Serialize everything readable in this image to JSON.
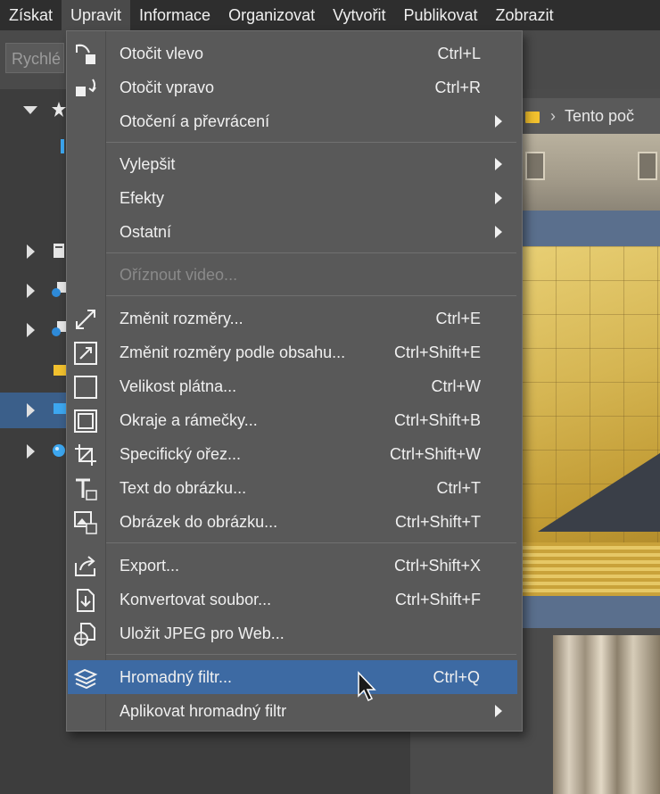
{
  "menubar": {
    "items": [
      "Získat",
      "Upravit",
      "Informace",
      "Organizovat",
      "Vytvořit",
      "Publikovat",
      "Zobrazit"
    ]
  },
  "search": {
    "text": "Rychlé"
  },
  "path": {
    "text": "Tento poč"
  },
  "dropdown": {
    "items": [
      {
        "label": "Otočit vlevo",
        "shortcut": "Ctrl+L",
        "icon": "rotate-left-icon"
      },
      {
        "label": "Otočit vpravo",
        "shortcut": "Ctrl+R",
        "icon": "rotate-right-icon"
      },
      {
        "label": "Otočení a převrácení",
        "shortcut": "",
        "submenu": true
      },
      {
        "label": "Vylepšit",
        "shortcut": "",
        "submenu": true
      },
      {
        "label": "Efekty",
        "shortcut": "",
        "submenu": true
      },
      {
        "label": "Ostatní",
        "shortcut": "",
        "submenu": true
      },
      {
        "label": "Oříznout video...",
        "shortcut": "",
        "disabled": true
      },
      {
        "label": "Změnit rozměry...",
        "shortcut": "Ctrl+E",
        "icon": "resize-icon"
      },
      {
        "label": "Změnit rozměry podle obsahu...",
        "shortcut": "Ctrl+Shift+E",
        "icon": "content-resize-icon"
      },
      {
        "label": "Velikost plátna...",
        "shortcut": "Ctrl+W",
        "icon": "canvas-size-icon"
      },
      {
        "label": "Okraje a rámečky...",
        "shortcut": "Ctrl+Shift+B",
        "icon": "frame-icon"
      },
      {
        "label": "Specifický ořez...",
        "shortcut": "Ctrl+Shift+W",
        "icon": "crop-icon"
      },
      {
        "label": "Text do obrázku...",
        "shortcut": "Ctrl+T",
        "icon": "text-icon"
      },
      {
        "label": "Obrázek do obrázku...",
        "shortcut": "Ctrl+Shift+T",
        "icon": "image-in-image-icon"
      },
      {
        "label": "Export...",
        "shortcut": "Ctrl+Shift+X",
        "icon": "export-icon"
      },
      {
        "label": "Konvertovat soubor...",
        "shortcut": "Ctrl+Shift+F",
        "icon": "convert-icon"
      },
      {
        "label": "Uložit JPEG pro Web...",
        "shortcut": "",
        "icon": "save-jpeg-web-icon"
      },
      {
        "label": "Hromadný filtr...",
        "shortcut": "Ctrl+Q",
        "icon": "batch-filter-icon",
        "highlighted": true
      },
      {
        "label": "Aplikovat hromadný filtr",
        "shortcut": "",
        "submenu": true
      }
    ]
  },
  "colors": {
    "menu_bg": "#595959",
    "highlight": "#3d6aa3",
    "menubar_bg": "#2e2e2e"
  }
}
